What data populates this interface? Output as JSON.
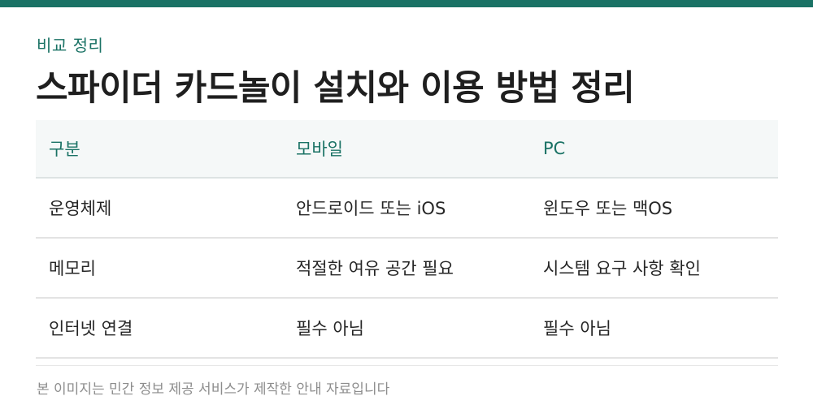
{
  "eyebrow": "비교 정리",
  "title": "스파이더 카드놀이 설치와 이용 방법 정리",
  "table": {
    "headers": [
      "구분",
      "모바일",
      "PC"
    ],
    "rows": [
      [
        "운영체제",
        "안드로이드 또는 iOS",
        "윈도우 또는 맥OS"
      ],
      [
        "메모리",
        "적절한 여유 공간 필요",
        "시스템 요구 사항 확인"
      ],
      [
        "인터넷 연결",
        "필수 아님",
        "필수 아님"
      ]
    ]
  },
  "footnote": "본 이미지는 민간 정보 제공 서비스가 제작한 안내 자료입니다",
  "colors": {
    "accent": "#1a7265",
    "header_bg": "#f5f8f8",
    "footnote": "#8d8d8d"
  }
}
